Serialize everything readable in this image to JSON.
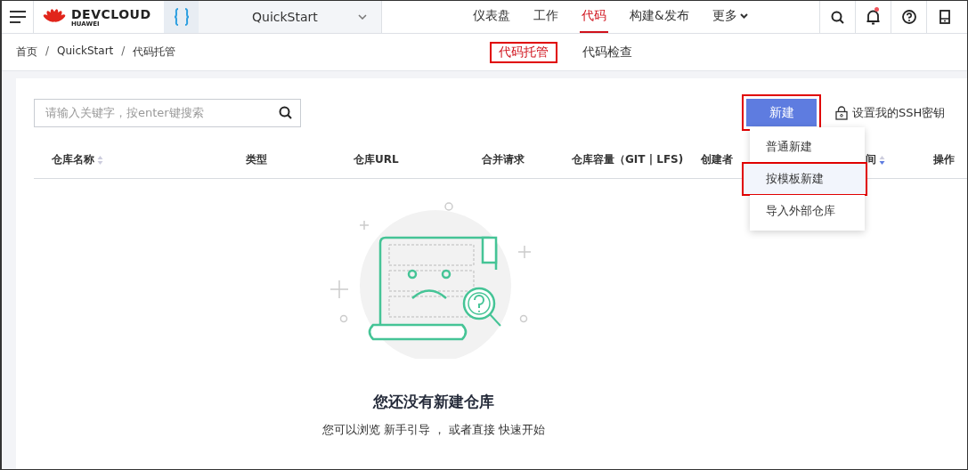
{
  "header": {
    "brand": "DEVCLOUD",
    "brand_sub": "HUAWEI",
    "project": "QuickStart",
    "nav": [
      {
        "label": "仪表盘",
        "selected": false
      },
      {
        "label": "工作",
        "selected": false
      },
      {
        "label": "代码",
        "selected": true
      },
      {
        "label": "构建&发布",
        "selected": false
      },
      {
        "label": "更多",
        "selected": false,
        "has_menu": true
      }
    ],
    "notifications_unread": true
  },
  "breadcrumb": [
    {
      "label": "首页"
    },
    {
      "separator": "/",
      "label": "QuickStart"
    },
    {
      "separator": "/",
      "label": "代码托管"
    }
  ],
  "subtabs": [
    {
      "label": "代码托管",
      "selected": true,
      "highlighted": true
    },
    {
      "label": "代码检查",
      "selected": false,
      "highlighted": false
    }
  ],
  "search": {
    "placeholder": "请输入关键字，按enter键搜索"
  },
  "new_button": {
    "label": "新建",
    "highlighted": true
  },
  "ssh_link": "设置我的SSH密钥",
  "columns": [
    {
      "label": "仓库名称",
      "sortable": true,
      "sorted_desc": false
    },
    {
      "label": "类型"
    },
    {
      "label": "仓库URL"
    },
    {
      "label": "合并请求"
    },
    {
      "label": "仓库容量（GIT | LFS)"
    },
    {
      "label": "创建者"
    },
    {
      "label": "间",
      "sortable": true,
      "sorted_desc": true
    },
    {
      "label": "操作"
    }
  ],
  "menu": [
    {
      "label": "普通新建",
      "selected": false,
      "highlighted": false
    },
    {
      "label": "按模板新建",
      "selected": true,
      "highlighted": true
    },
    {
      "label": "导入外部仓库",
      "selected": false,
      "highlighted": false
    }
  ],
  "empty": {
    "title": "您还没有新建仓库",
    "text": "您可以浏览 新手引导 ， 或者直接 快速开始"
  }
}
